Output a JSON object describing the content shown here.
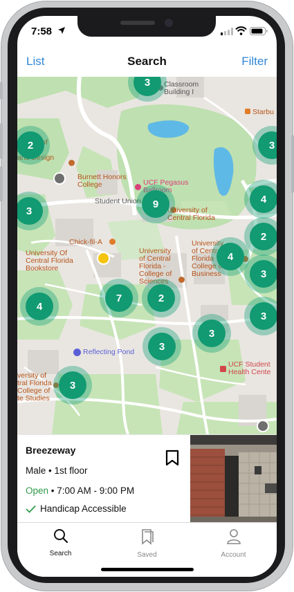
{
  "status": {
    "time": "7:58"
  },
  "nav": {
    "left": "List",
    "title": "Search",
    "right": "Filter"
  },
  "map": {
    "labels": {
      "classroom": "Classroom\nBuilding I",
      "starbucks": "Starbu",
      "school_arts": "School of\nArts\nand Design",
      "burnett": "Burnett Honors\nCollege",
      "pegasus": "UCF Pegasus\nBallroom",
      "student_union": "Student Union",
      "ucf": "University of\nCentral Florida",
      "chickfila": "Chick-fil-A",
      "bookstore": "University Of\nCentral Florida\nBookstore",
      "sciences": "University\nof Central\nFlorida -\nCollege of\nSciences",
      "business": "University\nof Central\nFlorida\nCollege of\nBusiness",
      "reflecting_pond": "Reflecting Pond",
      "health": "UCF Student\nHealth Cente",
      "graduate": "versity of\ntral Florida\nCollege of\nte Studies"
    },
    "clusters": [
      {
        "id": "c-top",
        "count": "3"
      },
      {
        "id": "c-left-top",
        "count": "2"
      },
      {
        "id": "c-right-top",
        "count": "3"
      },
      {
        "id": "c-union",
        "count": "9"
      },
      {
        "id": "c-left-mid",
        "count": "3"
      },
      {
        "id": "c-right-4",
        "count": "4"
      },
      {
        "id": "c-right-2",
        "count": "2"
      },
      {
        "id": "c-business",
        "count": "4"
      },
      {
        "id": "c-right-3a",
        "count": "3"
      },
      {
        "id": "c-left-4",
        "count": "4"
      },
      {
        "id": "c-7",
        "count": "7"
      },
      {
        "id": "c-sci-2",
        "count": "2"
      },
      {
        "id": "c-right-3b",
        "count": "3"
      },
      {
        "id": "c-3-mid",
        "count": "3"
      },
      {
        "id": "c-3-center",
        "count": "3"
      },
      {
        "id": "c-3-bottom",
        "count": "3"
      }
    ]
  },
  "card": {
    "title": "Breezeway",
    "sub": "Male • 1st floor",
    "open": "Open",
    "hours": " • 7:00 AM - 9:00 PM",
    "access": "Handicap Accessible"
  },
  "tabs": [
    {
      "label": "Search",
      "active": true
    },
    {
      "label": "Saved",
      "active": false
    },
    {
      "label": "Account",
      "active": false
    }
  ],
  "colors": {
    "accent": "#2f86d6",
    "cluster": "#129a72",
    "open": "#2f9a4a",
    "pin_yellow": "#f4c40f",
    "pin_gray": "#6f6f6f"
  }
}
